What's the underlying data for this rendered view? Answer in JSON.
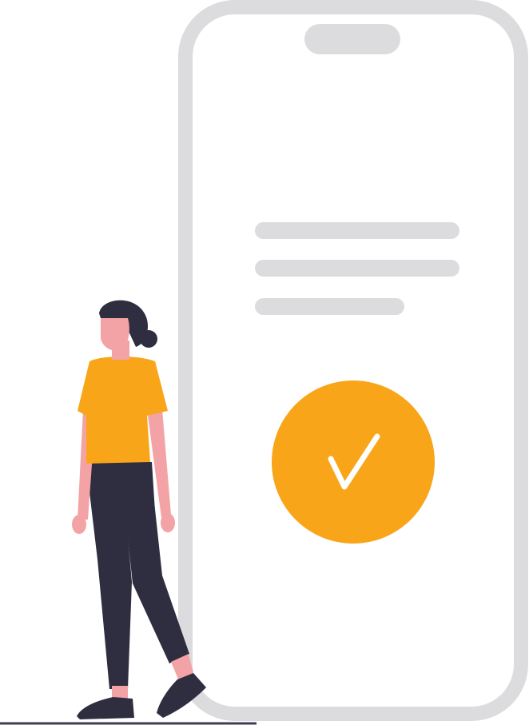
{
  "illustration": {
    "subject": "success-confirmation",
    "icons": [
      "phone-outline-icon",
      "checkmark-icon",
      "person-figure"
    ],
    "colors": {
      "phone_frame": "#DCDCDE",
      "notch": "#DCDCDE",
      "text_placeholder": "#DCDCDE",
      "accent": "#F9A51A",
      "check": "#FFFFFF",
      "skin": "#F3A3A5",
      "hair": "#2F2E41",
      "shirt": "#F9A51A",
      "pants": "#2F2E41",
      "shoes": "#2F2E41",
      "ground": "#3F3D56"
    }
  }
}
